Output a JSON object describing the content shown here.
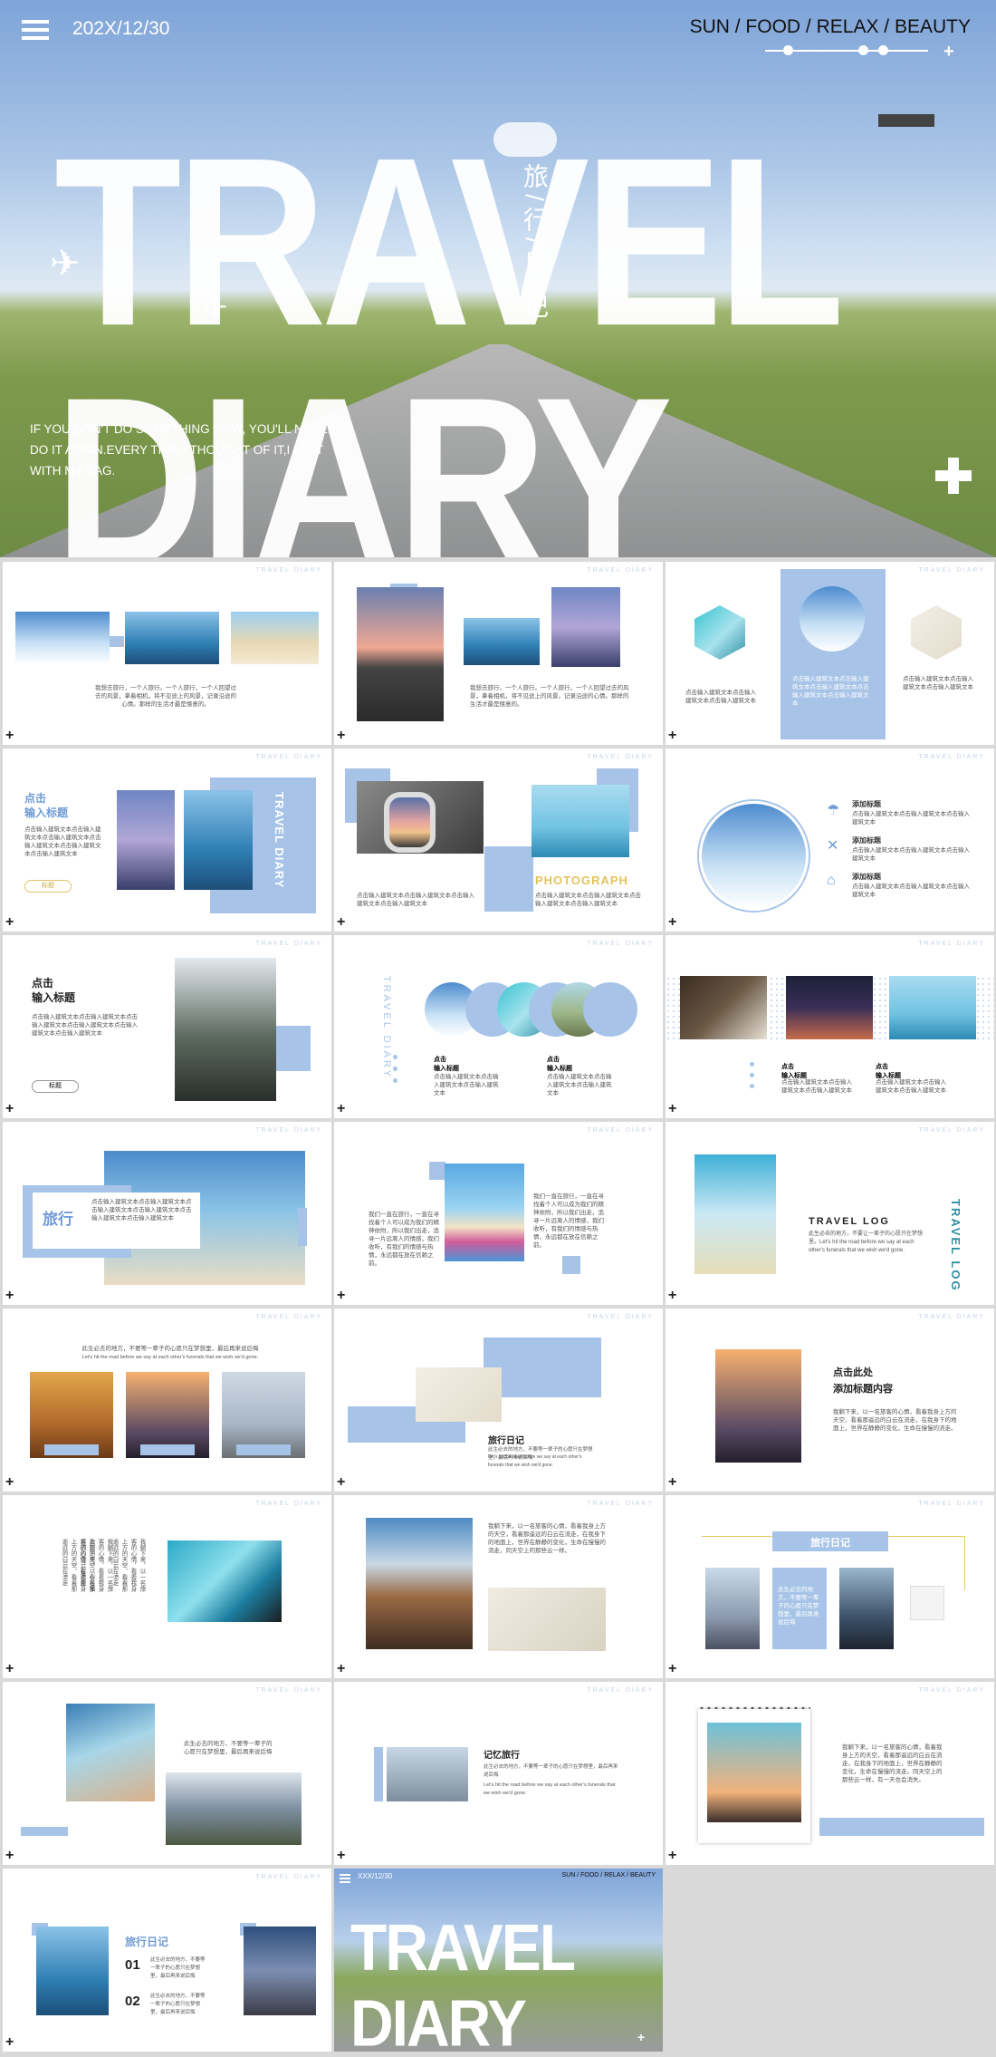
{
  "hero": {
    "date": "202X/12/30",
    "nav": "SUN  /  FOOD / RELAX / BEAUTY",
    "title_left": "TRAVEL",
    "title_right": "DIARY",
    "vertical_cn": "旅/行/日/记",
    "quote": "IF YOU DON'T DO SOMETHING NOW, YOU'LL NEVER DO IT AGAIN.EVERY TIME I THOUGHT OF IT,I LEFT WITH MY BAG."
  },
  "slides_common": {
    "tag": "TRAVEL DIARY",
    "plus": "+"
  },
  "s1": {
    "text": "我想去旅行，一个人旅行。一个人旅行，一个人回望过去的风景，拿着相机，将不见途上的风景，记录沿途的心情。那样的生活才最是惬意的。"
  },
  "s2": {
    "text": "我想去旅行，一个人旅行。一个人旅行，一个人回望过去的风景，拿着相机，将不见途上的风景，记录沿途的心情。那样的生活才最是惬意的。"
  },
  "s3": {
    "text_left": "点击输入建筑文本点击输入建筑文本点击输入建筑文本",
    "text_mid": "点击输入建筑文本点击输入建筑文本点击输入建筑文本点击输入建筑文本点击输入建筑文本",
    "text_right": "点击输入建筑文本点击输入建筑文本点击输入建筑文本"
  },
  "s4": {
    "title1": "点击",
    "title2": "输入标题",
    "text": "点击输入建筑文本点击输入建筑文本点击输入建筑文本点击输入建筑文本点击输入建筑文本点击输入建筑文本",
    "button": "标题",
    "vertical": "TRAVEL DIARY"
  },
  "s5": {
    "label": "PHOTOGRAPH",
    "text": "点击输入建筑文本点击输入建筑文本点击输入建筑文本点击输入建筑文本"
  },
  "s6": {
    "items": [
      {
        "title": "添加标题",
        "text": "点击输入建筑文本点击输入建筑文本点击输入建筑文本"
      },
      {
        "title": "添加标题",
        "text": "点击输入建筑文本点击输入建筑文本点击输入建筑文本"
      },
      {
        "title": "添加标题",
        "text": "点击输入建筑文本点击输入建筑文本点击输入建筑文本"
      }
    ]
  },
  "s7": {
    "title1": "点击",
    "title2": "输入标题",
    "text": "点击输入建筑文本点击输入建筑文本点击输入建筑文本点击输入建筑文本点击输入建筑文本点击输入建筑文本",
    "button": "标题"
  },
  "s8": {
    "vertical": "TRAVEL DIARY",
    "h1": "点击",
    "h1b": "输入标题",
    "h2": "点击",
    "h2b": "输入标题",
    "text": "点击输入建筑文本点击输入建筑文本点击输入建筑文本"
  },
  "s9": {
    "h1": "点击",
    "h1b": "输入标题",
    "h2": "点击",
    "h2b": "输入标题",
    "text": "点击输入建筑文本点击输入建筑文本点击输入建筑文本"
  },
  "s10": {
    "title": "旅行",
    "text": "点击输入建筑文本点击输入建筑文本点击输入建筑文本点击输入建筑文本点击输入建筑文本点击输入建筑文本"
  },
  "s11": {
    "text_left": "我们一直在旅行，一直在寻找着个人可以成为我们的精神依附，所以我们出走，追寻一片远离人的情感，我们收听，有我们的情感与热情，永远都在放在信赖之前。",
    "text_right": "我们一直在旅行，一直在寻找着个人可以成为我们的精神依附，所以我们出走，追寻一片远离人的情感，我们收听，有我们的情感与热情，永远都在放在信赖之前。"
  },
  "s12": {
    "title": "TRAVEL LOG",
    "text": "此生必去的地方，不要让一辈子的心愿只在梦想里。Let's hit the road before we say at each other's funerals that we wish we'd gone.",
    "vertical": "TRAVEL LOG"
  },
  "s13": {
    "text": "此生必去的地方，不要等一辈子的心愿只在梦想里，最后再来说后悔",
    "sub": "Let's hit the road before we say at each other's funerals that we wish we'd gone."
  },
  "s14": {
    "title": "旅行日记",
    "text": "此生必去的地方，不要等一辈子的心愿只在梦想里，最后再来说后悔",
    "sub": "Let's hit the road before we say at each other's funerals that we wish we'd gone."
  },
  "s15": {
    "title1": "点击此处",
    "title2": "添加标题内容",
    "text": "我躺下来，以一名旅客的心情，看着我身上方的天空、看着那遥远的白云在流走，在我身下的地面上，世界在静静的变化，生命在慢慢的流走。"
  },
  "s16": {
    "text": "我躺下来，以一名旅客的心情，看着我身上方的天空、看着那遥远的白云在流走"
  },
  "s17": {
    "text": "我躺下来，以一名旅客的心情，看着我身上方的天空，看着那遥远的白云在流走，在我身下的地面上，世界在静静的变化，生命在慢慢的流走，同天空上的那些云一样。"
  },
  "s18": {
    "title": "旅行日记",
    "text": "此生必去的地方，不要等一辈子的心愿只在梦想里，最后再来说后悔"
  },
  "s19": {
    "text": "此生必去的地方，不要等一辈子的心愿只在梦想里，最后再来说后悔"
  },
  "s20": {
    "title": "记忆旅行",
    "text": "此生必去的地方，不要等一辈子的心愿只在梦想里，最后再来说后悔",
    "sub": "Let's hit the road before we say at each other's funerals that we wish we'd gone."
  },
  "s21": {
    "text": "我躺下来，以一名旅客的心情，看着我身上方的天空，看着那遥远的白云在流走，在我身下的地面上，世界在静静的变化，生命在慢慢的流走。同天空上的那些云一样，有一天也会消失。"
  },
  "s22": {
    "title": "旅行日记",
    "items": [
      {
        "num": "01",
        "text": "此生必去的地方，不要等一辈子的心愿只在梦想里，最后再来说后悔"
      },
      {
        "num": "02",
        "text": "此生必去的地方，不要等一辈子的心愿只在梦想里，最后再来说后悔"
      }
    ]
  },
  "s23": {
    "date": "XXX/12/30",
    "nav": "SUN / FOOD / RELAX / BEAUTY",
    "title": "TRAVEL DIARY"
  },
  "colors": {
    "accent_blue": "#a7c4e8",
    "text_blue": "#6f9bd4",
    "background": "#d9d9d9"
  }
}
